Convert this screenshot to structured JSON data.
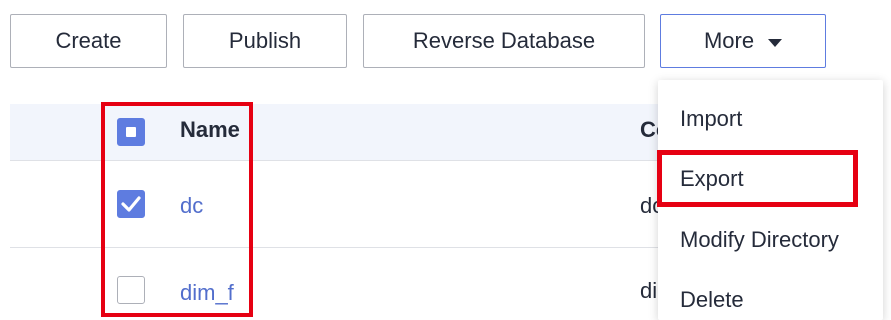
{
  "toolbar": {
    "create_label": "Create",
    "publish_label": "Publish",
    "reverse_label": "Reverse Database",
    "more_label": "More"
  },
  "table": {
    "columns": [
      "Name",
      "Co"
    ],
    "rows": [
      {
        "name": "dc",
        "second_col": "dc",
        "checked": true
      },
      {
        "name": "dim_f",
        "second_col": "di",
        "checked": false
      }
    ]
  },
  "more_menu": {
    "items": [
      "Import",
      "Export",
      "Modify Directory",
      "Delete"
    ]
  },
  "colors": {
    "accent": "#5e7ce0",
    "link": "#526ecc",
    "highlight": "#e60012",
    "header_bg": "#f2f5fc"
  }
}
